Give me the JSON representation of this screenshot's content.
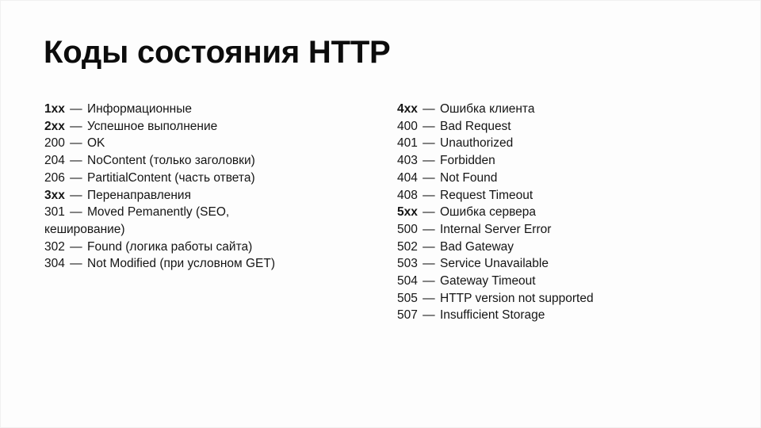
{
  "slide": {
    "title": "Коды состояния HTTP",
    "background_color": "#fdfdfd",
    "text_color": "#151515",
    "dash": "—"
  },
  "columns": {
    "left": {
      "name": "left-column",
      "lines": [
        {
          "code": "1xx",
          "dash": "—",
          "desc": "Информационные",
          "group": true,
          "wrap": false
        },
        {
          "code": "2xx",
          "dash": "—",
          "desc": "Успешное выполнение",
          "group": true,
          "wrap": false
        },
        {
          "code": "200",
          "dash": "—",
          "desc": "OK",
          "group": false,
          "wrap": false
        },
        {
          "code": "204",
          "dash": "—",
          "desc": "NoContent (только заголовки)",
          "group": false,
          "wrap": false
        },
        {
          "code": "206",
          "dash": "—",
          "desc": "PartitialContent (часть ответа)",
          "group": false,
          "wrap": false
        },
        {
          "code": "3xx",
          "dash": "—",
          "desc": "Перенаправления",
          "group": true,
          "wrap": false
        },
        {
          "code": "301",
          "dash": "—",
          "desc": "Moved Pemanently (SEO, кеширование)",
          "group": false,
          "wrap": true
        },
        {
          "code": "302",
          "dash": "—",
          "desc": "Found (логика работы сайта)",
          "group": false,
          "wrap": false
        },
        {
          "code": "304",
          "dash": "—",
          "desc": "Not Modified (при условном GET)",
          "group": false,
          "wrap": false
        }
      ]
    },
    "right": {
      "name": "right-column",
      "lines": [
        {
          "code": "4xx",
          "dash": "—",
          "desc": "Ошибка клиента",
          "group": true,
          "wrap": false
        },
        {
          "code": "400",
          "dash": "—",
          "desc": "Bad Request",
          "group": false,
          "wrap": false
        },
        {
          "code": "401",
          "dash": "—",
          "desc": "Unauthorized",
          "group": false,
          "wrap": false
        },
        {
          "code": "403",
          "dash": "—",
          "desc": "Forbidden",
          "group": false,
          "wrap": false
        },
        {
          "code": "404",
          "dash": "—",
          "desc": "Not Found",
          "group": false,
          "wrap": false
        },
        {
          "code": "408",
          "dash": "—",
          "desc": "Request Timeout",
          "group": false,
          "wrap": false
        },
        {
          "code": "5xx",
          "dash": "—",
          "desc": "Ошибка сервера",
          "group": true,
          "wrap": false
        },
        {
          "code": "500",
          "dash": "—",
          "desc": "Internal Server Error",
          "group": false,
          "wrap": false
        },
        {
          "code": "502",
          "dash": "—",
          "desc": "Bad Gateway",
          "group": false,
          "wrap": false
        },
        {
          "code": "503",
          "dash": "—",
          "desc": "Service Unavailable",
          "group": false,
          "wrap": false
        },
        {
          "code": "504",
          "dash": "—",
          "desc": "Gateway Timeout",
          "group": false,
          "wrap": false
        },
        {
          "code": "505",
          "dash": "—",
          "desc": "HTTP version not supported",
          "group": false,
          "wrap": false
        },
        {
          "code": "507",
          "dash": "—",
          "desc": "Insufficient Storage",
          "group": false,
          "wrap": false
        }
      ]
    }
  }
}
